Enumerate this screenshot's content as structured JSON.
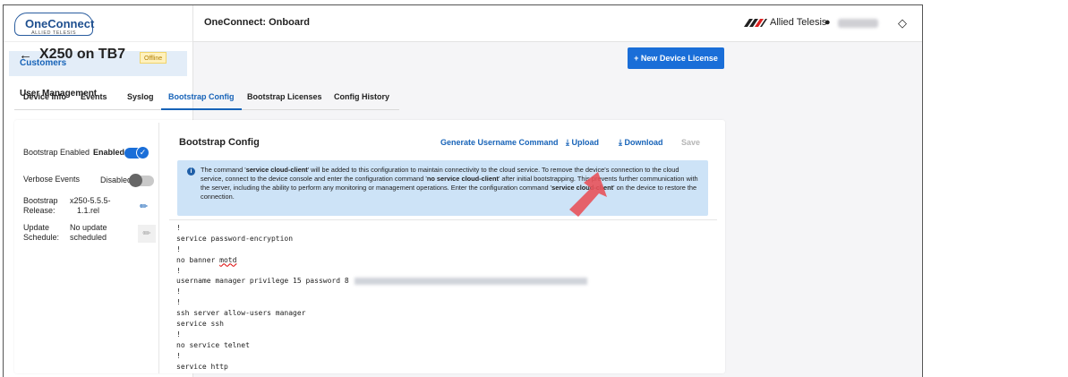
{
  "sidebar": {
    "logo": {
      "name": "OneConnect",
      "sub": "ALLIED TELESIS"
    },
    "items": [
      {
        "label": "Customers",
        "active": true
      },
      {
        "label": "User Management",
        "active": false
      }
    ]
  },
  "topbar": {
    "title": "OneConnect: Onboard",
    "brand": "Allied Telesis",
    "icons": [
      "user-icon",
      "diamond-icon"
    ]
  },
  "device": {
    "back_icon": "←",
    "title": "X250 on TB7",
    "status": "Offline",
    "new_license_label": "+ New Device License"
  },
  "tabs": [
    {
      "label": "Device Info",
      "active": false
    },
    {
      "label": "Events",
      "active": false
    },
    {
      "label": "Syslog",
      "active": false
    },
    {
      "label": "Bootstrap Config",
      "active": true
    },
    {
      "label": "Bootstrap Licenses",
      "active": false
    },
    {
      "label": "Config History",
      "active": false
    }
  ],
  "settings": {
    "bootstrap_enabled": {
      "label": "Bootstrap Enabled",
      "value": "Enabled",
      "on": true
    },
    "verbose_events": {
      "label": "Verbose Events",
      "value": "Disabled",
      "on": false
    },
    "release": {
      "label_1": "Bootstrap",
      "label_2": "Release:",
      "value_1": "x250-5.5.5-",
      "value_2": "1.1.rel"
    },
    "schedule": {
      "label_1": "Update",
      "label_2": "Schedule:",
      "value_1": "No update",
      "value_2": "scheduled"
    }
  },
  "config": {
    "title": "Bootstrap Config",
    "actions": {
      "generate": "Generate Username Command",
      "upload": "Upload",
      "download": "Download",
      "save": "Save"
    },
    "info": {
      "t1": "The command '",
      "b1": "service cloud-client",
      "t2": "' will be added to this configuration to maintain connectivity to the cloud service. To remove the device's connection to the cloud service, connect to the device console and enter the configuration command '",
      "b2": "no service cloud-client",
      "t3": "' after initial bootstrapping. This prevents further communication with the server, including the ability to perform any monitoring or management operations. Enter the configuration command '",
      "b3": "service cloud-client",
      "t4": "' on the device to restore the connection."
    },
    "lines": [
      "!",
      "service password-encryption",
      "!",
      "no banner ",
      "motd",
      "!",
      "username manager privilege 15 password 8",
      "!",
      "!",
      "ssh server allow-users manager",
      "service ssh",
      "!",
      "no service telnet",
      "!",
      "service http"
    ]
  },
  "colors": {
    "accent": "#1a6ed8",
    "info_bg": "#cde3f7",
    "badge_text": "#b07d00",
    "badge_bg": "#fff1bd",
    "arrow": "#e8525a"
  }
}
